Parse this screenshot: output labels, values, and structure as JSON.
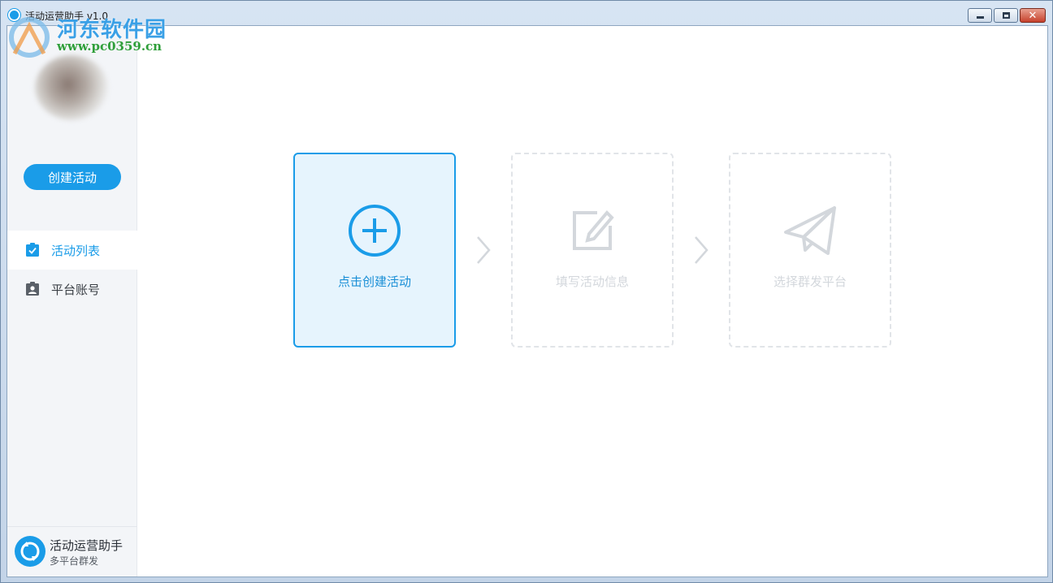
{
  "window": {
    "title": "活动运营助手 v1.0",
    "controls": {
      "minimize": "minimize",
      "maximize": "maximize",
      "close": "✕"
    }
  },
  "watermark": {
    "title": "河东软件园",
    "url": "www.pc0359.cn"
  },
  "sidebar": {
    "create_button": "创建活动",
    "items": [
      {
        "label": "活动列表",
        "icon": "checkbox-icon",
        "active": true
      },
      {
        "label": "平台账号",
        "icon": "contact-card-icon",
        "active": false
      }
    ],
    "footer": {
      "title": "活动运营助手",
      "subtitle": "多平台群发"
    }
  },
  "steps": [
    {
      "label": "点击创建活动",
      "icon": "plus-circle-icon",
      "state": "active"
    },
    {
      "label": "填写活动信息",
      "icon": "edit-icon",
      "state": "disabled"
    },
    {
      "label": "选择群发平台",
      "icon": "paper-plane-icon",
      "state": "disabled"
    }
  ],
  "colors": {
    "accent": "#1a9ce8",
    "active_bg": "#e6f4fd",
    "disabled": "#d3d7dc",
    "sidebar_bg": "#f3f5f8"
  }
}
